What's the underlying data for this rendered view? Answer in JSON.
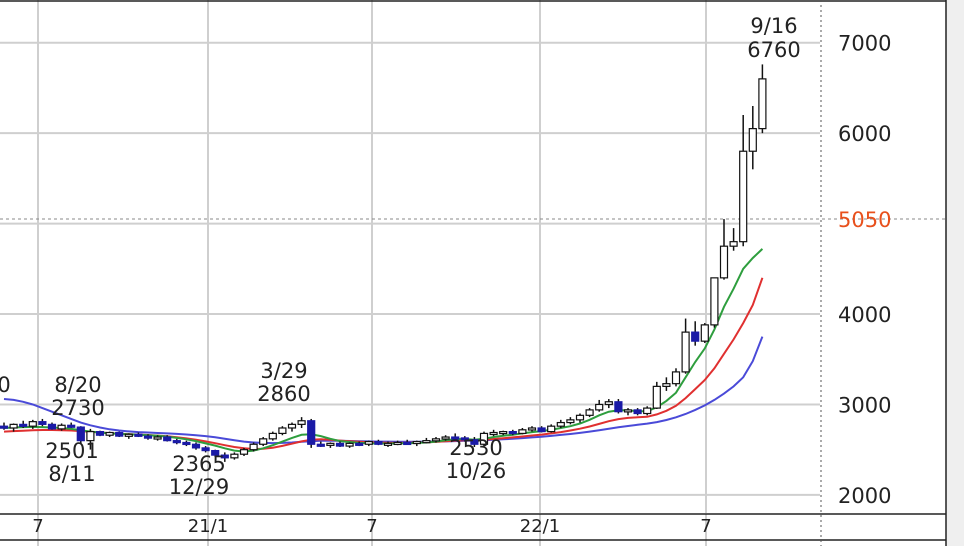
{
  "chart_data": {
    "type": "candlestick",
    "title": "",
    "ylim": [
      1800,
      7450
    ],
    "yticks": [
      2000,
      3000,
      4000,
      5000,
      6000,
      7000
    ],
    "ytick_labels": [
      "2000",
      "3000",
      "4000",
      "",
      "6000",
      "7000"
    ],
    "xtick_labels": [
      "7",
      "21/1",
      "7",
      "22/1",
      "7"
    ],
    "last_price": {
      "value": 5050,
      "label": "5050",
      "color": "#e8501c"
    },
    "grid": true,
    "colors": {
      "up_candle": "#ffffff",
      "down_candle": "#1a1aa6",
      "ma_short": "#2e9e3e",
      "ma_mid": "#e03030",
      "ma_long": "#4a4ad8"
    },
    "annotations": [
      {
        "date": "8/20",
        "value": 2730,
        "label_date": "8/20",
        "label_value": "2730",
        "kind": "high"
      },
      {
        "date": "8/11",
        "value": 2501,
        "label_date": "8/11",
        "label_value": "2501",
        "kind": "low"
      },
      {
        "date": "12/29",
        "value": 2365,
        "label_date": "12/29",
        "label_value": "2365",
        "kind": "low"
      },
      {
        "date": "3/29",
        "value": 2860,
        "label_date": "3/29",
        "label_value": "2860",
        "kind": "high"
      },
      {
        "date": "10/26",
        "value": 2530,
        "label_date": "10/26",
        "label_value": "2530",
        "kind": "low"
      },
      {
        "date": "9/16",
        "value": 6760,
        "label_date": "9/16",
        "label_value": "6760",
        "kind": "high"
      }
    ],
    "edge_label": "0",
    "candles": [
      [
        2760,
        2800,
        2720,
        2740
      ],
      [
        2740,
        2790,
        2700,
        2780
      ],
      [
        2780,
        2820,
        2740,
        2760
      ],
      [
        2760,
        2830,
        2730,
        2810
      ],
      [
        2810,
        2840,
        2760,
        2780
      ],
      [
        2780,
        2800,
        2720,
        2730
      ],
      [
        2730,
        2790,
        2710,
        2770
      ],
      [
        2770,
        2800,
        2740,
        2750
      ],
      [
        2750,
        2760,
        2560,
        2600
      ],
      [
        2600,
        2730,
        2501,
        2700
      ],
      [
        2700,
        2710,
        2650,
        2660
      ],
      [
        2660,
        2700,
        2640,
        2690
      ],
      [
        2690,
        2700,
        2640,
        2650
      ],
      [
        2650,
        2680,
        2620,
        2670
      ],
      [
        2670,
        2690,
        2640,
        2650
      ],
      [
        2650,
        2670,
        2610,
        2630
      ],
      [
        2630,
        2660,
        2600,
        2640
      ],
      [
        2640,
        2660,
        2590,
        2600
      ],
      [
        2600,
        2620,
        2560,
        2580
      ],
      [
        2580,
        2600,
        2540,
        2560
      ],
      [
        2560,
        2580,
        2500,
        2520
      ],
      [
        2520,
        2540,
        2470,
        2490
      ],
      [
        2490,
        2500,
        2420,
        2440
      ],
      [
        2440,
        2470,
        2365,
        2410
      ],
      [
        2410,
        2470,
        2390,
        2450
      ],
      [
        2450,
        2520,
        2430,
        2500
      ],
      [
        2500,
        2580,
        2480,
        2560
      ],
      [
        2560,
        2640,
        2540,
        2620
      ],
      [
        2620,
        2700,
        2600,
        2680
      ],
      [
        2680,
        2760,
        2660,
        2740
      ],
      [
        2740,
        2800,
        2700,
        2780
      ],
      [
        2780,
        2860,
        2740,
        2820
      ],
      [
        2820,
        2840,
        2520,
        2560
      ],
      [
        2560,
        2590,
        2530,
        2550
      ],
      [
        2550,
        2580,
        2520,
        2570
      ],
      [
        2570,
        2590,
        2530,
        2540
      ],
      [
        2540,
        2580,
        2520,
        2570
      ],
      [
        2570,
        2590,
        2540,
        2560
      ],
      [
        2560,
        2600,
        2540,
        2590
      ],
      [
        2590,
        2610,
        2550,
        2560
      ],
      [
        2560,
        2590,
        2530,
        2570
      ],
      [
        2570,
        2600,
        2550,
        2580
      ],
      [
        2580,
        2610,
        2560,
        2570
      ],
      [
        2570,
        2600,
        2540,
        2590
      ],
      [
        2590,
        2630,
        2570,
        2600
      ],
      [
        2600,
        2640,
        2580,
        2620
      ],
      [
        2620,
        2660,
        2600,
        2640
      ],
      [
        2640,
        2680,
        2610,
        2630
      ],
      [
        2630,
        2650,
        2590,
        2610
      ],
      [
        2610,
        2640,
        2530,
        2560
      ],
      [
        2560,
        2700,
        2540,
        2680
      ],
      [
        2680,
        2720,
        2650,
        2690
      ],
      [
        2690,
        2710,
        2660,
        2700
      ],
      [
        2700,
        2720,
        2660,
        2680
      ],
      [
        2680,
        2740,
        2670,
        2720
      ],
      [
        2720,
        2760,
        2700,
        2740
      ],
      [
        2740,
        2760,
        2690,
        2700
      ],
      [
        2700,
        2780,
        2690,
        2760
      ],
      [
        2760,
        2830,
        2740,
        2800
      ],
      [
        2800,
        2860,
        2780,
        2830
      ],
      [
        2830,
        2900,
        2800,
        2880
      ],
      [
        2880,
        2960,
        2860,
        2940
      ],
      [
        2940,
        3050,
        2920,
        3000
      ],
      [
        3000,
        3060,
        2960,
        3030
      ],
      [
        3030,
        3060,
        2900,
        2920
      ],
      [
        2920,
        2960,
        2880,
        2940
      ],
      [
        2940,
        2960,
        2880,
        2900
      ],
      [
        2900,
        2980,
        2880,
        2960
      ],
      [
        2960,
        3250,
        2950,
        3200
      ],
      [
        3200,
        3300,
        3150,
        3230
      ],
      [
        3230,
        3400,
        3200,
        3360
      ],
      [
        3360,
        3950,
        3340,
        3800
      ],
      [
        3800,
        3920,
        3650,
        3700
      ],
      [
        3700,
        3900,
        3680,
        3880
      ],
      [
        3880,
        4400,
        3850,
        4400
      ],
      [
        4400,
        5050,
        4380,
        4750
      ],
      [
        4750,
        4950,
        4700,
        4800
      ],
      [
        4800,
        6200,
        4750,
        5800
      ],
      [
        5800,
        6300,
        5600,
        6050
      ],
      [
        6050,
        6760,
        6000,
        6600
      ]
    ],
    "ma_short": [
      2740,
      2745,
      2750,
      2752,
      2750,
      2745,
      2740,
      2730,
      2715,
      2700,
      2690,
      2680,
      2675,
      2670,
      2665,
      2660,
      2655,
      2645,
      2630,
      2615,
      2595,
      2570,
      2545,
      2515,
      2490,
      2480,
      2490,
      2515,
      2550,
      2590,
      2630,
      2665,
      2670,
      2650,
      2620,
      2595,
      2585,
      2575,
      2570,
      2568,
      2568,
      2570,
      2572,
      2575,
      2580,
      2590,
      2605,
      2615,
      2618,
      2610,
      2620,
      2640,
      2655,
      2665,
      2680,
      2695,
      2705,
      2720,
      2740,
      2760,
      2790,
      2830,
      2880,
      2920,
      2935,
      2935,
      2925,
      2925,
      2970,
      3040,
      3130,
      3300,
      3470,
      3620,
      3830,
      4080,
      4280,
      4500,
      4620,
      4720
    ],
    "ma_mid": [
      2700,
      2705,
      2710,
      2715,
      2718,
      2718,
      2716,
      2712,
      2705,
      2698,
      2690,
      2683,
      2677,
      2672,
      2667,
      2662,
      2656,
      2648,
      2638,
      2625,
      2610,
      2592,
      2572,
      2550,
      2530,
      2515,
      2508,
      2510,
      2522,
      2542,
      2566,
      2592,
      2610,
      2615,
      2610,
      2600,
      2593,
      2587,
      2582,
      2578,
      2576,
      2575,
      2576,
      2578,
      2581,
      2586,
      2593,
      2600,
      2605,
      2606,
      2610,
      2618,
      2627,
      2636,
      2646,
      2657,
      2667,
      2680,
      2695,
      2712,
      2732,
      2756,
      2785,
      2815,
      2838,
      2852,
      2858,
      2864,
      2890,
      2930,
      2985,
      3070,
      3170,
      3270,
      3400,
      3560,
      3720,
      3900,
      4100,
      4400
    ],
    "ma_long": [
      3060,
      3050,
      3030,
      3000,
      2960,
      2920,
      2880,
      2840,
      2800,
      2770,
      2745,
      2725,
      2712,
      2702,
      2695,
      2690,
      2685,
      2680,
      2675,
      2668,
      2660,
      2650,
      2638,
      2622,
      2605,
      2590,
      2580,
      2575,
      2573,
      2575,
      2580,
      2587,
      2594,
      2598,
      2599,
      2598,
      2596,
      2594,
      2592,
      2590,
      2589,
      2588,
      2588,
      2588,
      2589,
      2590,
      2592,
      2595,
      2598,
      2600,
      2604,
      2609,
      2615,
      2621,
      2628,
      2636,
      2644,
      2653,
      2663,
      2674,
      2686,
      2700,
      2715,
      2732,
      2748,
      2762,
      2775,
      2788,
      2805,
      2828,
      2858,
      2895,
      2940,
      2990,
      3050,
      3120,
      3200,
      3300,
      3480,
      3750
    ]
  }
}
